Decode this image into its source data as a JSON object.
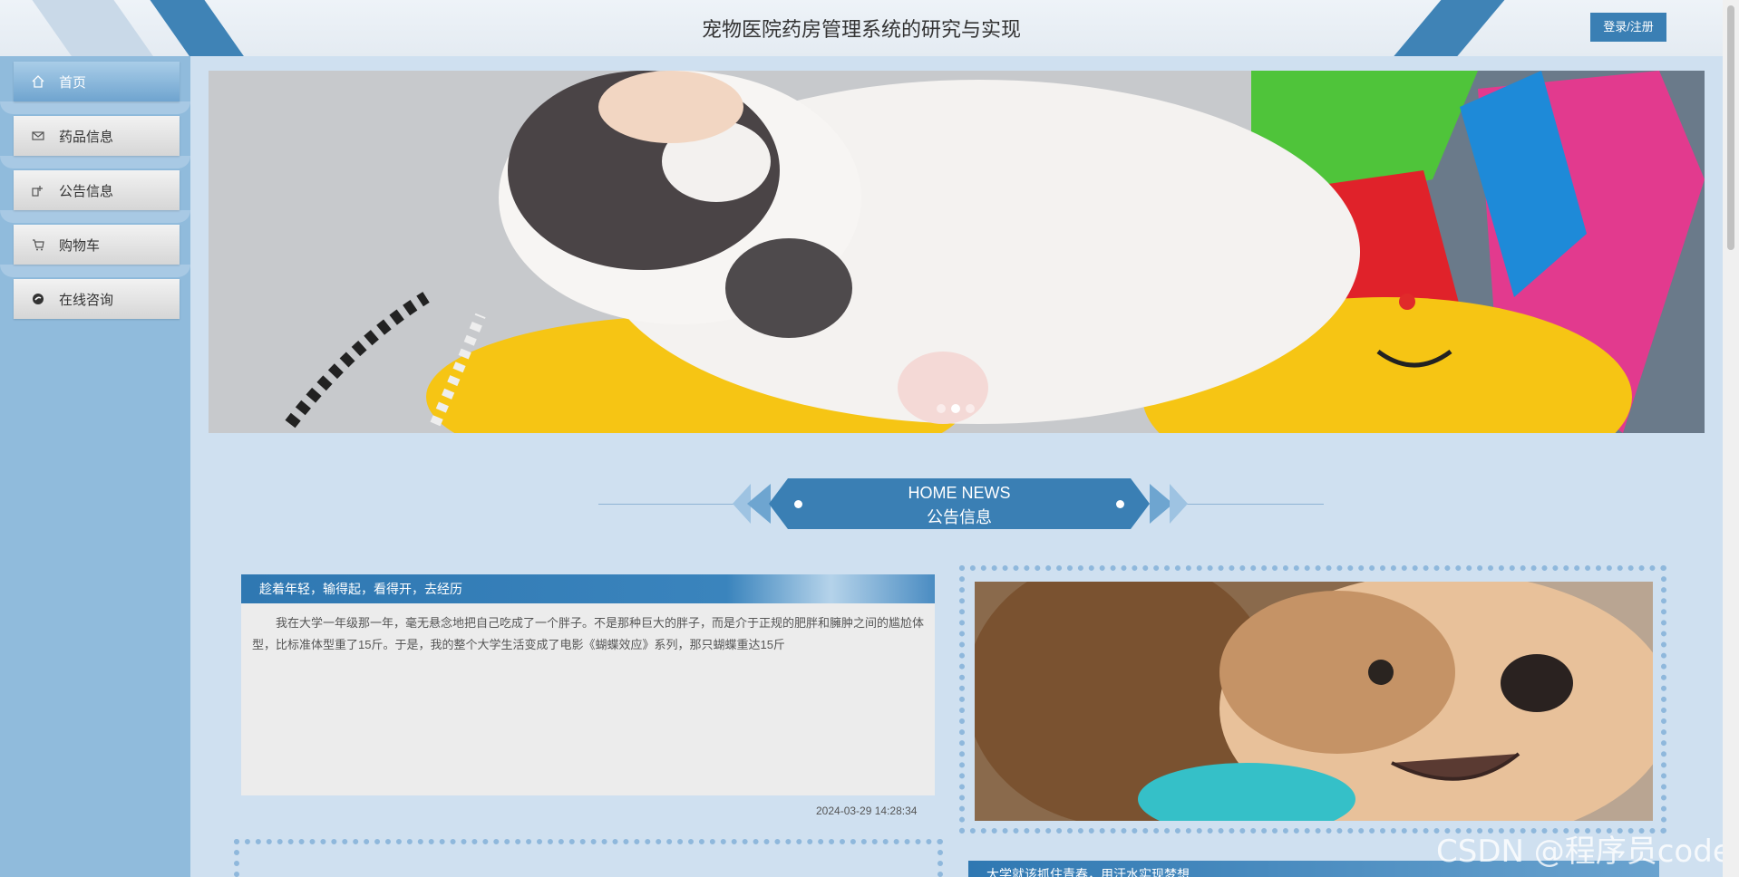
{
  "header": {
    "title": "宠物医院药房管理系统的研究与实现",
    "login_label": "登录/注册"
  },
  "sidebar": {
    "items": [
      {
        "label": "首页",
        "icon": "home-icon",
        "active": true
      },
      {
        "label": "药品信息",
        "icon": "mail-icon",
        "active": false
      },
      {
        "label": "公告信息",
        "icon": "notice-icon",
        "active": false
      },
      {
        "label": "购物车",
        "icon": "cart-icon",
        "active": false
      },
      {
        "label": "在线咨询",
        "icon": "chat-icon",
        "active": false
      }
    ]
  },
  "banner": {
    "slide_count": 3,
    "active_slide": 2
  },
  "section": {
    "en_title": "HOME NEWS",
    "cn_title": "公告信息"
  },
  "news": [
    {
      "title": "趁着年轻，输得起，看得开，去经历",
      "body": "我在大学一年级那一年，毫无悬念地把自己吃成了一个胖子。不是那种巨大的胖子，而是介于正规的肥胖和臃肿之间的尴尬体型，比标准体型重了15斤。于是，我的整个大学生活变成了电影《蝴蝶效应》系列，那只蝴蝶重达15斤",
      "date": "2024-03-29 14:28:34"
    },
    {
      "title": "大学就该抓住青春，用汗水实现梦想"
    }
  ],
  "watermark": "CSDN @程序员code",
  "colors": {
    "accent": "#3a7fb4",
    "sidebar_bg": "#90bbdc",
    "page_bg": "#cfe0f0"
  }
}
